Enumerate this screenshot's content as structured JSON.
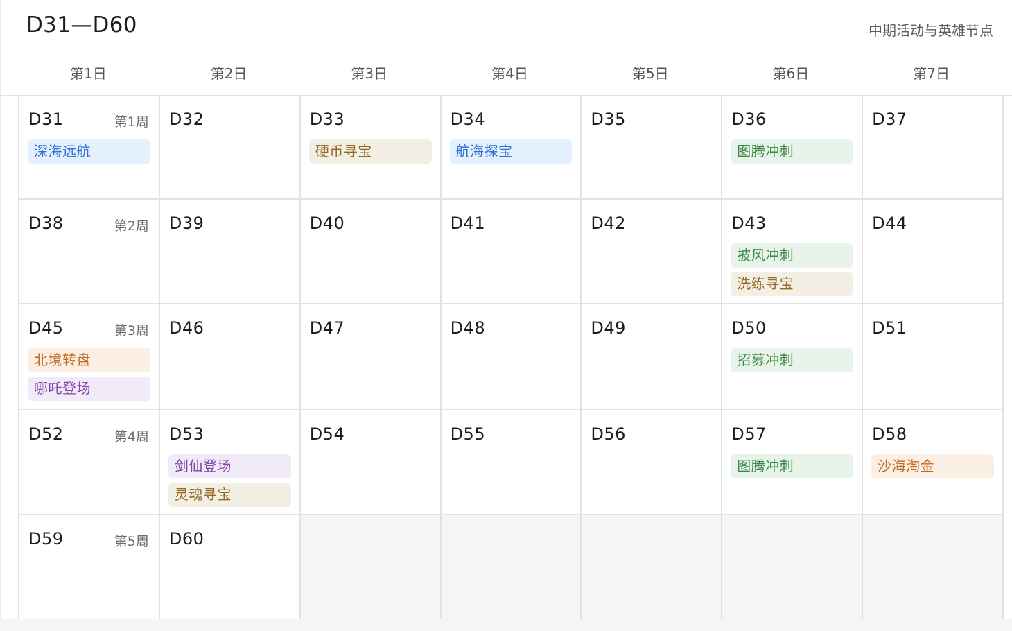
{
  "header": {
    "title": "D31—D60",
    "subtitle": "中期活动与英雄节点"
  },
  "weekdays": [
    "第1日",
    "第2日",
    "第3日",
    "第4日",
    "第5日",
    "第6日",
    "第7日"
  ],
  "colors": {
    "blue": "#2f6fd6",
    "tan": "#916a23",
    "green": "#3b8a44",
    "orange": "#c16a23",
    "purple": "#8343aa"
  },
  "weeks": [
    {
      "week_label": "第1周",
      "days": [
        {
          "day": "D31",
          "events": [
            {
              "label": "深海远航",
              "color": "blue"
            }
          ]
        },
        {
          "day": "D32",
          "events": []
        },
        {
          "day": "D33",
          "events": [
            {
              "label": "硬币寻宝",
              "color": "tan"
            }
          ]
        },
        {
          "day": "D34",
          "events": [
            {
              "label": "航海探宝",
              "color": "blue"
            }
          ]
        },
        {
          "day": "D35",
          "events": []
        },
        {
          "day": "D36",
          "events": [
            {
              "label": "图腾冲刺",
              "color": "green"
            }
          ]
        },
        {
          "day": "D37",
          "events": []
        }
      ]
    },
    {
      "week_label": "第2周",
      "days": [
        {
          "day": "D38",
          "events": []
        },
        {
          "day": "D39",
          "events": []
        },
        {
          "day": "D40",
          "events": []
        },
        {
          "day": "D41",
          "events": []
        },
        {
          "day": "D42",
          "events": []
        },
        {
          "day": "D43",
          "events": [
            {
              "label": "披风冲刺",
              "color": "green"
            },
            {
              "label": "洗练寻宝",
              "color": "tan"
            }
          ]
        },
        {
          "day": "D44",
          "events": []
        }
      ]
    },
    {
      "week_label": "第3周",
      "days": [
        {
          "day": "D45",
          "events": [
            {
              "label": "北境转盘",
              "color": "orange"
            },
            {
              "label": "哪吒登场",
              "color": "purple"
            }
          ]
        },
        {
          "day": "D46",
          "events": []
        },
        {
          "day": "D47",
          "events": []
        },
        {
          "day": "D48",
          "events": []
        },
        {
          "day": "D49",
          "events": []
        },
        {
          "day": "D50",
          "events": [
            {
              "label": "招募冲刺",
              "color": "green"
            }
          ]
        },
        {
          "day": "D51",
          "events": []
        }
      ]
    },
    {
      "week_label": "第4周",
      "days": [
        {
          "day": "D52",
          "events": []
        },
        {
          "day": "D53",
          "events": [
            {
              "label": "剑仙登场",
              "color": "purple"
            },
            {
              "label": "灵魂寻宝",
              "color": "tan"
            }
          ]
        },
        {
          "day": "D54",
          "events": []
        },
        {
          "day": "D55",
          "events": []
        },
        {
          "day": "D56",
          "events": []
        },
        {
          "day": "D57",
          "events": [
            {
              "label": "图腾冲刺",
              "color": "green"
            }
          ]
        },
        {
          "day": "D58",
          "events": [
            {
              "label": "沙海淘金",
              "color": "orange"
            }
          ]
        }
      ]
    },
    {
      "week_label": "第5周",
      "days": [
        {
          "day": "D59",
          "events": []
        },
        {
          "day": "D60",
          "events": []
        }
      ]
    }
  ]
}
